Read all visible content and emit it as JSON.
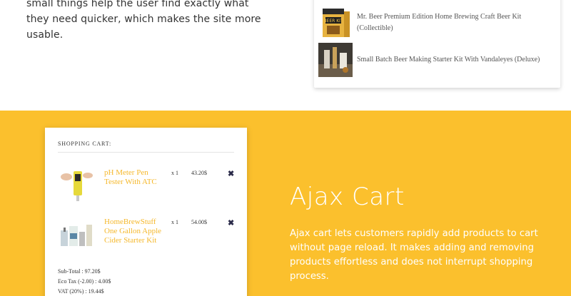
{
  "intro": {
    "text": "small things help the user find exactly what they need quicker, which makes the site more usable."
  },
  "search_results": {
    "items": [
      {
        "name": "Mr. Beer Premium Edition Home Brewing Craft Beer Kit (Collectible)",
        "thumb_icon": "beer-kit-box-icon"
      },
      {
        "name": "Small Batch Beer Making Starter Kit With Vandaleyes (Deluxe)",
        "thumb_icon": "brewing-kit-photo-icon"
      }
    ]
  },
  "cart": {
    "title": "SHOPPING CART:",
    "items": [
      {
        "name": "pH Meter Pen Tester With ATC",
        "qty": "x 1",
        "price": "43.20$",
        "remove_icon": "close-icon"
      },
      {
        "name": "HomeBrewStuff One Gallon Apple Cider Starter Kit",
        "qty": "x 1",
        "price": "54.00$",
        "remove_icon": "close-icon"
      }
    ],
    "subtotal": "Sub-Total : 97.20$",
    "eco_tax": "Eco Tax (-2.00) : 4.00$",
    "vat": "VAT (20%) : 19.44$"
  },
  "feature": {
    "title": "Ajax Cart",
    "description": "Ajax cart lets customers rapidly add products to cart without page reload. It makes adding and removing products effortless and does not interrupt shopping process."
  },
  "colors": {
    "accent_yellow": "#fbc02d",
    "product_link": "#f5b82c",
    "remove_icon": "#2b2b4a"
  }
}
